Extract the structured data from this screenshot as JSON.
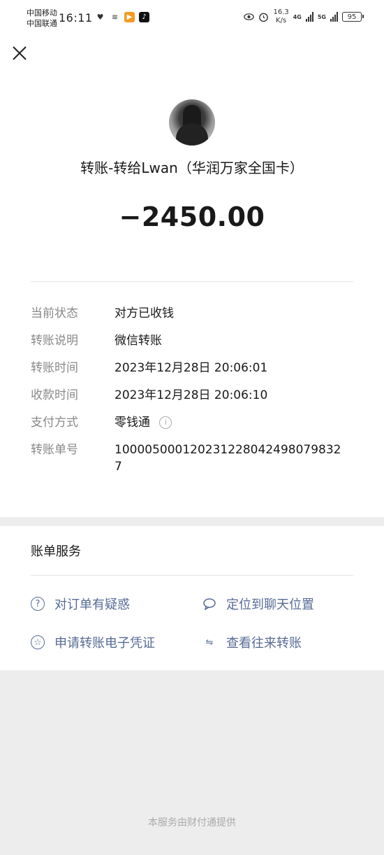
{
  "status_bar": {
    "carrier1": "中国移动",
    "carrier2": "中国联通",
    "time": "16:11",
    "net_speed_value": "16.3",
    "net_speed_unit": "K/s",
    "gen1": "4G",
    "gen2": "5G",
    "battery": "95"
  },
  "header": {
    "close_icon": "close-icon"
  },
  "transfer": {
    "title": "转账-转给Lwan（华润万家全国卡）",
    "amount": "−2450.00",
    "details": [
      {
        "label": "当前状态",
        "value": "对方已收钱"
      },
      {
        "label": "转账说明",
        "value": "微信转账"
      },
      {
        "label": "转账时间",
        "value": "2023年12月28日 20:06:01"
      },
      {
        "label": "收款时间",
        "value": "2023年12月28日 20:06:10"
      },
      {
        "label": "支付方式",
        "value": "零钱通"
      },
      {
        "label": "转账单号",
        "value": "100005000120231228042498079832 7"
      }
    ]
  },
  "bill_services": {
    "title": "账单服务",
    "items": [
      {
        "label": "对订单有疑惑",
        "icon": "question-circle-icon"
      },
      {
        "label": "定位到聊天位置",
        "icon": "chat-bubble-icon"
      },
      {
        "label": "申请转账电子凭证",
        "icon": "star-circle-icon"
      },
      {
        "label": "查看往来转账",
        "icon": "swap-arrows-icon"
      }
    ]
  },
  "footer": {
    "text": "本服务由财付通提供"
  },
  "colors": {
    "link": "#576b95",
    "label_gray": "#888888",
    "background": "#ededed"
  }
}
